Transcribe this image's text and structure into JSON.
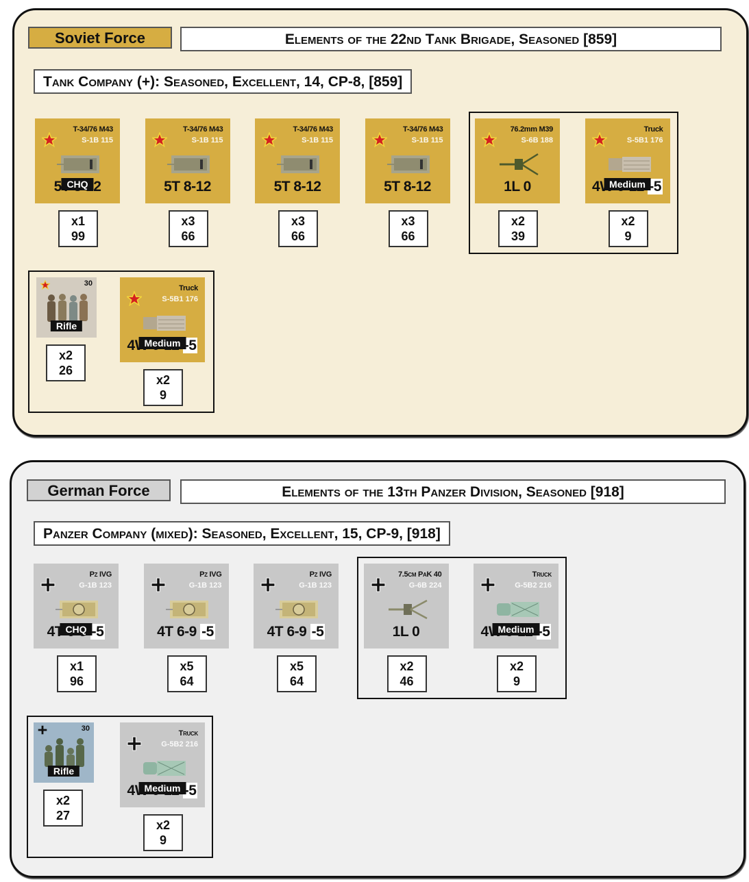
{
  "soviet": {
    "force_label": "Soviet Force",
    "force_title": "Elements of the 22nd Tank Brigade, Seasoned [859]",
    "company": "Tank Company (+): Seasoned, Excellent, 14, CP-8, [859]",
    "colors": {
      "counter": "#d6ad42",
      "panel": "#f6eed8"
    },
    "units": [
      {
        "name": "T-34/76 M43",
        "code": "S-1B 115",
        "stats": "5T 8-12",
        "tag": "CHQ",
        "icon": "tank-icon",
        "count": "x1",
        "points": "99"
      },
      {
        "name": "T-34/76 M43",
        "code": "S-1B 115",
        "stats": "5T 8-12",
        "icon": "tank-icon",
        "count": "x3",
        "points": "66"
      },
      {
        "name": "T-34/76 M43",
        "code": "S-1B 115",
        "stats": "5T 8-12",
        "icon": "tank-icon",
        "count": "x3",
        "points": "66"
      },
      {
        "name": "T-34/76 M43",
        "code": "S-1B 115",
        "stats": "5T 8-12",
        "icon": "tank-icon",
        "count": "x3",
        "points": "66"
      },
      {
        "name": "76.2mm M39",
        "code": "S-6B 188",
        "stats": "1L 0",
        "icon": "gun-icon",
        "count": "x2",
        "points": "39"
      },
      {
        "name": "Truck",
        "code": "S-5B1 176",
        "stats": "4W 6-12",
        "neg": "-5",
        "tag": "Medium",
        "icon": "truck-icon",
        "count": "x2",
        "points": "9"
      }
    ],
    "infantry": {
      "label": "Rifle",
      "number": "30",
      "count": "x2",
      "points": "26"
    },
    "infantry_truck": {
      "name": "Truck",
      "code": "S-5B1 176",
      "stats": "4W 6-12",
      "neg": "-5",
      "tag": "Medium",
      "count": "x2",
      "points": "9"
    }
  },
  "german": {
    "force_label": "German Force",
    "force_title": "Elements of the 13th Panzer Division, Seasoned [918]",
    "company": "Panzer Company (mixed): Seasoned, Excellent, 15, CP-9, [918]",
    "colors": {
      "counter": "#c8c8c8",
      "panel": "#f0f0f0"
    },
    "units": [
      {
        "name": "Pz IVG",
        "code": "G-1B 123",
        "stats": "4T 6-9",
        "neg": "-5",
        "tag": "CHQ",
        "icon": "tank-icon",
        "count": "x1",
        "points": "96"
      },
      {
        "name": "Pz IVG",
        "code": "G-1B 123",
        "stats": "4T 6-9",
        "neg": "-5",
        "icon": "tank-icon",
        "count": "x5",
        "points": "64"
      },
      {
        "name": "Pz IVG",
        "code": "G-1B 123",
        "stats": "4T 6-9",
        "neg": "-5",
        "icon": "tank-icon",
        "count": "x5",
        "points": "64"
      },
      {
        "name": "7.5cm PaK 40",
        "code": "G-6B 224",
        "stats": "1L 0",
        "icon": "gun-icon",
        "count": "x2",
        "points": "46"
      },
      {
        "name": "Truck",
        "code": "G-5B2 216",
        "stats": "4W 6-12",
        "neg": "-5",
        "tag": "Medium",
        "icon": "truck-icon",
        "count": "x2",
        "points": "9"
      }
    ],
    "infantry": {
      "label": "Rifle",
      "number": "30",
      "count": "x2",
      "points": "27"
    },
    "infantry_truck": {
      "name": "Truck",
      "code": "G-5B2 216",
      "stats": "4W 6-12",
      "neg": "-5",
      "tag": "Medium",
      "count": "x2",
      "points": "9"
    }
  }
}
